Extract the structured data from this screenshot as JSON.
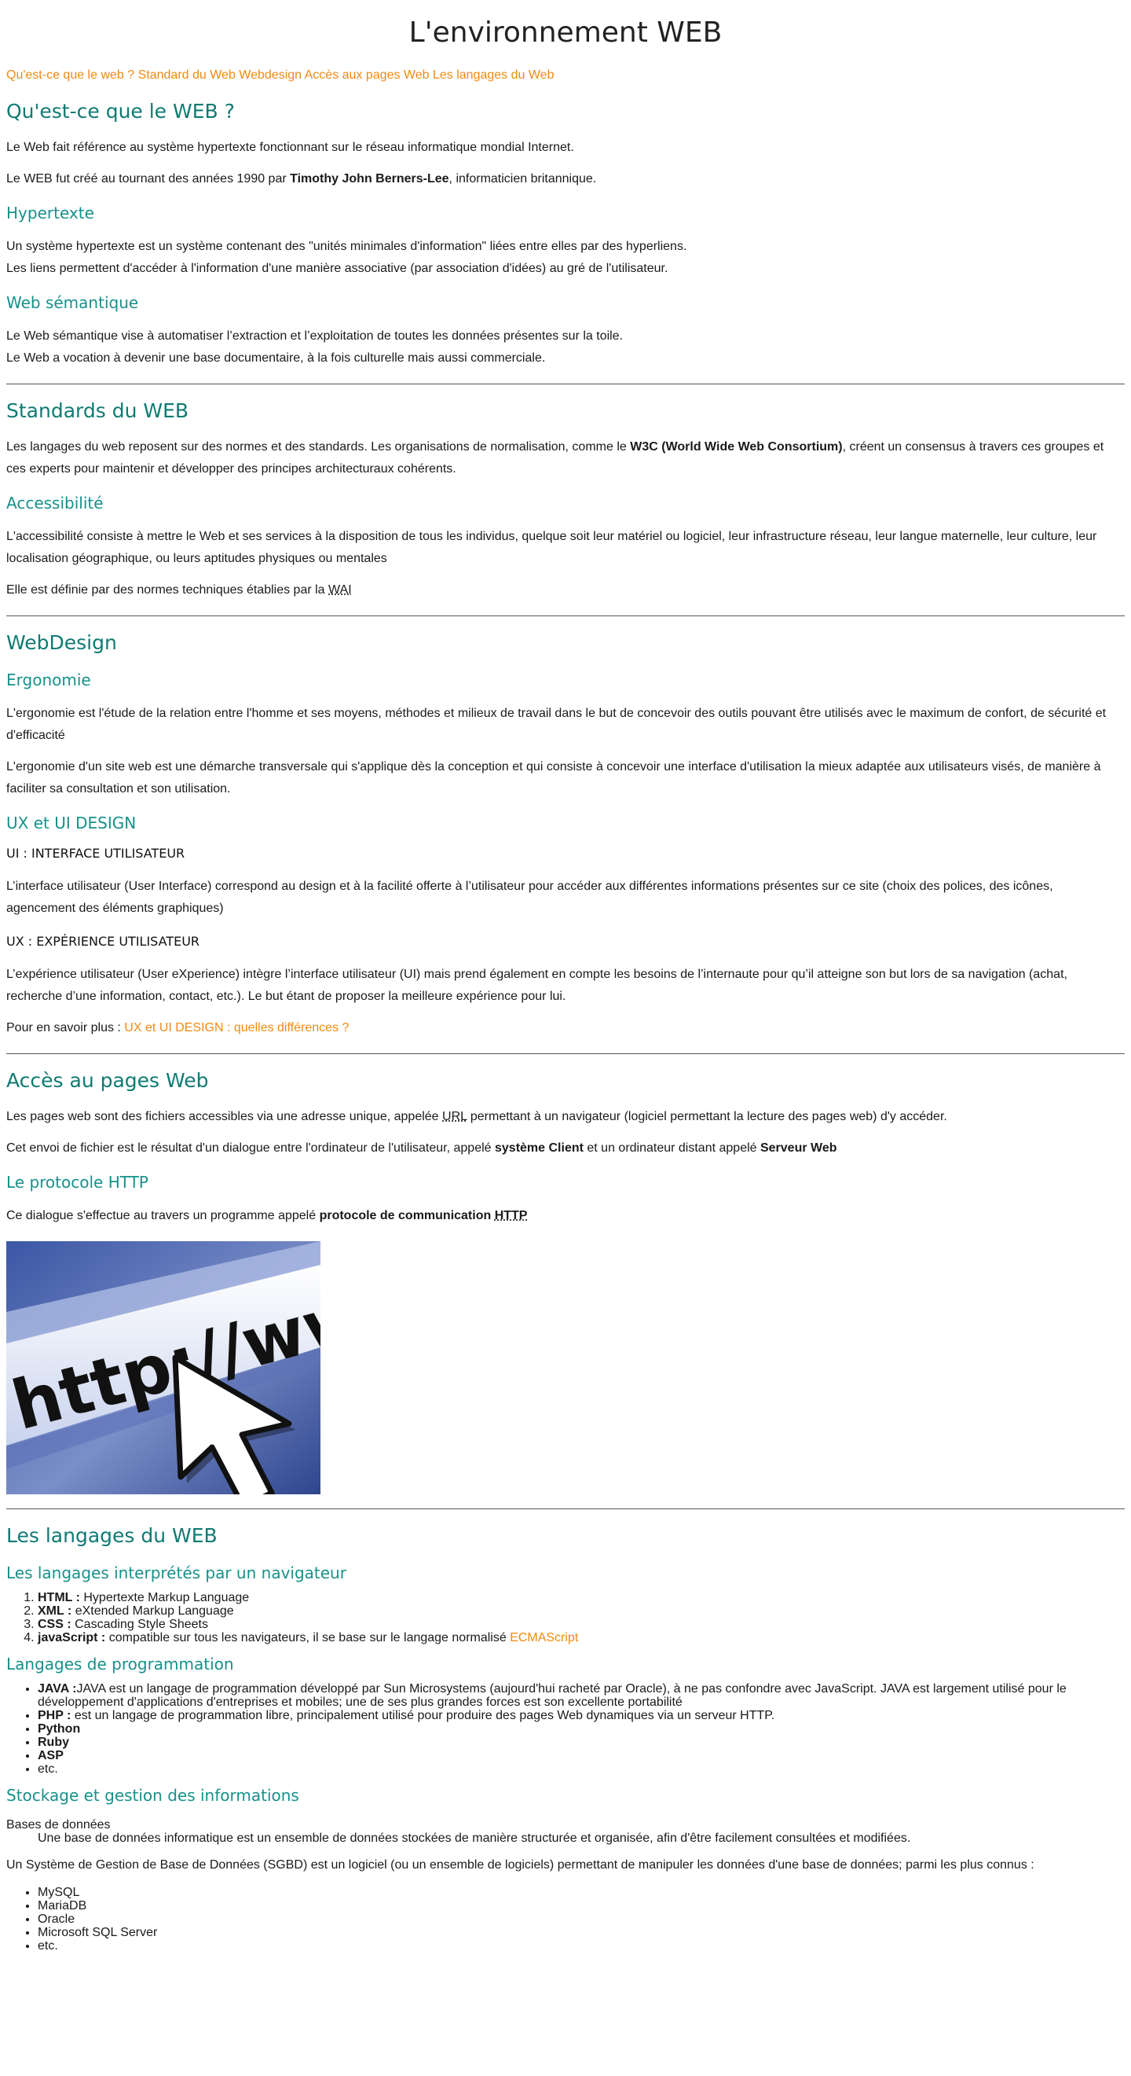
{
  "title": "L'environnement WEB",
  "nav": [
    "Qu'est-ce que le web ?",
    "Standard du Web",
    "Webdesign",
    "Accès aux pages Web",
    "Les langages du Web"
  ],
  "s1": {
    "h2": "Qu'est-ce que le WEB ?",
    "p1": "Le Web fait référence au système hypertexte fonctionnant sur le réseau informatique mondial Internet.",
    "p2_a": "Le WEB fut créé au tournant des années 1990 par ",
    "p2_b": "Timothy John Berners-Lee",
    "p2_c": ", informaticien britannique.",
    "h3a": "Hypertexte",
    "hyp1": "Un système hypertexte est un système contenant des \"unités minimales d'information\" liées entre elles par des hyperliens.",
    "hyp2": "Les liens permettent d'accéder à l'information d'une manière associative (par association d'idées) au gré de l'utilisateur.",
    "h3b": "Web sémantique",
    "sem1": "Le Web sémantique vise à automatiser l’extraction et l’exploitation de toutes les données présentes sur la toile.",
    "sem2": "Le Web a vocation à devenir une base documentaire, à la fois culturelle mais aussi commerciale."
  },
  "s2": {
    "h2": "Standards du WEB",
    "p1_a": "Les langages du web reposent sur des normes et des standards. Les organisations de normalisation, comme le ",
    "p1_b": "W3C (World Wide Web Consortium)",
    "p1_c": ", créent un consensus à travers ces groupes et ces experts pour maintenir et développer des principes architecturaux cohérents.",
    "h3": "Accessibilité",
    "p2": "L'accessibilité consiste à mettre le Web et ses services à la disposition de tous les individus, quelque soit leur matériel ou logiciel, leur infrastructure réseau, leur langue maternelle, leur culture, leur localisation géographique, ou leurs aptitudes physiques ou mentales",
    "p3_a": "Elle est définie par des normes techniques établies par la ",
    "p3_abbr": "WAI"
  },
  "s3": {
    "h2": "WebDesign",
    "h3a": "Ergonomie",
    "erg1": "L'ergonomie est l'étude de la relation entre l'homme et ses moyens, méthodes et milieux de travail dans le but de concevoir des outils pouvant être utilisés avec le maximum de confort, de sécurité et d'efficacité",
    "erg2": "L'ergonomie d'un site web est une démarche transversale qui s'applique dès la conception et qui consiste à concevoir une interface d'utilisation la mieux adaptée aux utilisateurs visés, de manière à faciliter sa consultation et son utilisation.",
    "h3b": "UX et UI DESIGN",
    "h4a": "UI : INTERFACE UTILISATEUR",
    "ui": "L’interface utilisateur (User Interface) correspond au design et à la facilité offerte à l’utilisateur pour accéder aux différentes informations présentes sur ce site (choix des polices, des icônes, agencement des éléments graphiques)",
    "h4b": "UX : EXPÉRIENCE UTILISATEUR",
    "ux": "L’expérience utilisateur (User eXperience) intègre l’interface utilisateur (UI) mais prend également en compte les besoins de l’internaute pour qu’il atteigne son but lors de sa navigation (achat, recherche d’une information, contact, etc.). Le but étant de proposer la meilleure expérience pour lui.",
    "more_a": "Pour en savoir plus : ",
    "more_link": "UX et UI DESIGN : quelles différences ?"
  },
  "s4": {
    "h2": "Accès au pages Web",
    "p1_a": "Les pages web sont des fichiers accessibles via une adresse unique, appelée ",
    "p1_abbr": "URL",
    "p1_c": " permettant à un navigateur (logiciel permettant la lecture des pages web) d'y accéder.",
    "p2_a": "Cet envoi de fichier est le résultat d'un dialogue entre l'ordinateur de l'utilisateur, appelé ",
    "p2_b": "système Client",
    "p2_c": " et un ordinateur distant appelé ",
    "p2_d": "Serveur Web",
    "h3": "Le protocole HTTP",
    "p3_a": "Ce dialogue s'effectue au travers un programme appelé ",
    "p3_b": "protocole de communication ",
    "p3_abbr": "HTTP",
    "img_text": "http://www"
  },
  "s5": {
    "h2": "Les langages du WEB",
    "h3a": "Les langages interprétés par un navigateur",
    "ol": [
      {
        "b": "HTML :",
        "t": " Hypertexte Markup Language"
      },
      {
        "b": "XML :",
        "t": " eXtended Markup Language"
      },
      {
        "b": "CSS :",
        "t": " Cascading Style Sheets"
      },
      {
        "b": "javaScript :",
        "t": " compatible sur tous les navigateurs, il se base sur le langage normalisé "
      }
    ],
    "ecma": "ECMAScript",
    "h3b": "Langages de programmation",
    "ul": [
      {
        "b": "JAVA :",
        "t": "JAVA est un langage de programmation développé par Sun Microsystems (aujourd'hui racheté par Oracle), à ne pas confondre avec JavaScript. JAVA est largement utilisé pour le développement d'applications d'entreprises et mobiles; une de ses plus grandes forces est son excellente portabilité"
      },
      {
        "b": "PHP :",
        "t": " est un langage de programmation libre, principalement utilisé pour produire des pages Web dynamiques via un serveur HTTP."
      },
      {
        "b": "Python",
        "t": ""
      },
      {
        "b": "Ruby",
        "t": ""
      },
      {
        "b": "ASP",
        "t": ""
      },
      {
        "b": "",
        "t": "etc."
      }
    ],
    "h3c": "Stockage et gestion des informations",
    "dt": "Bases de données",
    "dd": "Une base de données informatique est un ensemble de données stockées de manière structurée et organisée, afin d'être facilement consultées et modifiées.",
    "sgbd": "Un Système de Gestion de Base de Données (SGBD) est un logiciel (ou un ensemble de logiciels) permettant de manipuler les données d'une base de données; parmi les plus connus :",
    "db": [
      "MySQL",
      "MariaDB",
      "Oracle",
      "Microsoft SQL Server",
      "etc."
    ]
  }
}
